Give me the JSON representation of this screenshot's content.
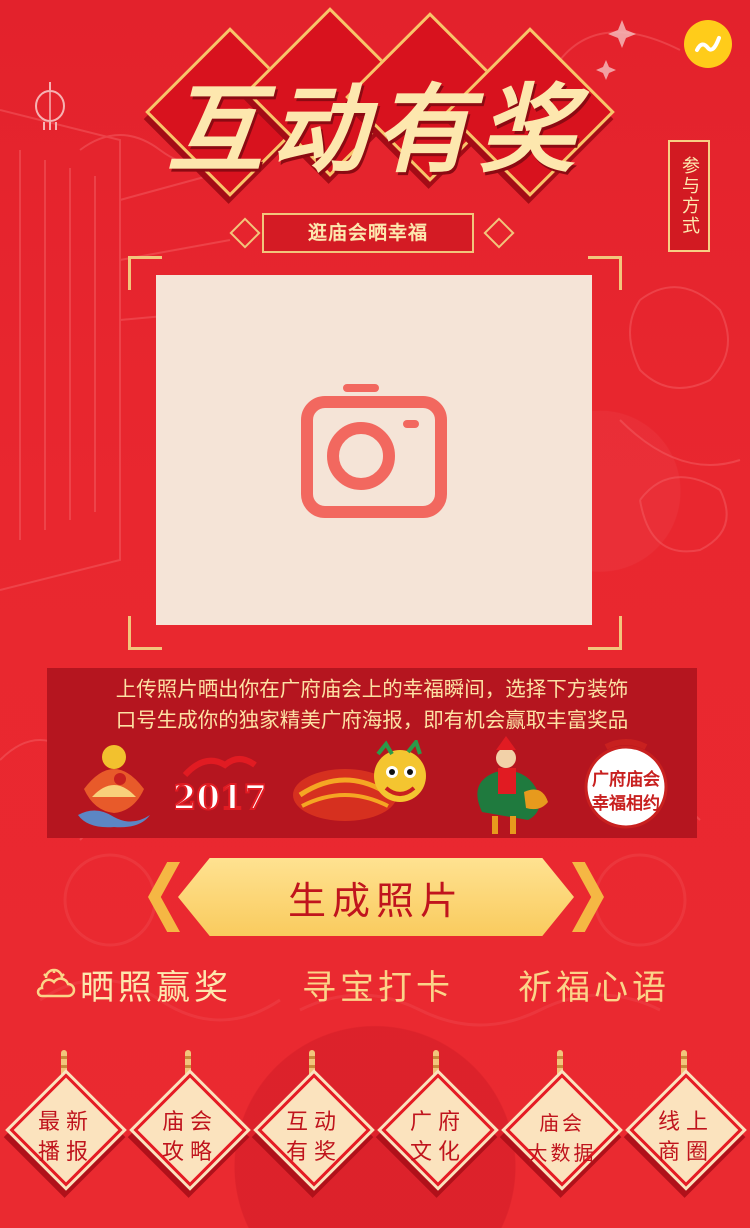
{
  "header": {
    "title": "互动有奖",
    "subtitle": "逛庙会晒幸福",
    "side_label": "参与方式"
  },
  "icons": {
    "corner": "music-note-icon",
    "camera": "camera-icon",
    "lantern": "lantern-icon",
    "cloud": "cloud-icon"
  },
  "description": {
    "line1": "上传照片晒出你在广府庙会上的幸福瞬间，选择下方装饰",
    "line2": "口号生成你的独家精美广府海报，即有机会赢取丰富奖品"
  },
  "stickers": [
    {
      "name": "rooster-fan-sticker"
    },
    {
      "name": "2017-sticker",
      "text": "2017"
    },
    {
      "name": "lion-dance-sticker"
    },
    {
      "name": "rooster-rider-sticker"
    },
    {
      "name": "miaohui-text-sticker",
      "text": "广府庙会幸福相约"
    }
  ],
  "generate_button": "生成照片",
  "tabs": [
    {
      "label": "晒照赢奖",
      "active": true
    },
    {
      "label": "寻宝打卡",
      "active": false
    },
    {
      "label": "祈福心语",
      "active": false
    }
  ],
  "bottom_nav": [
    {
      "line1": "最新",
      "line2": "播报"
    },
    {
      "line1": "庙会",
      "line2": "攻略"
    },
    {
      "line1": "互动",
      "line2": "有奖"
    },
    {
      "line1": "广府",
      "line2": "文化"
    },
    {
      "line1": "庙会",
      "line2": "大数据"
    },
    {
      "line1": "线上",
      "line2": "商圈"
    }
  ],
  "colors": {
    "background": "#e9262f",
    "gold": "#fde7ae",
    "button": "#f9cb5e",
    "photo_bg": "#f5e4d7",
    "camera": "#f2685f"
  }
}
